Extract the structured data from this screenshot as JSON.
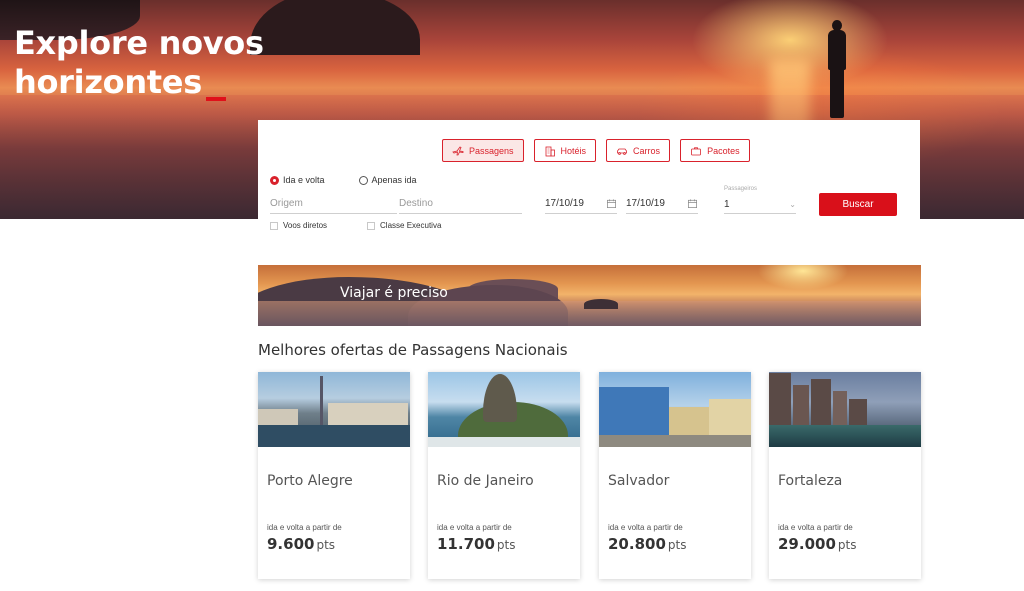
{
  "hero": {
    "title_line1": "Explore novos",
    "title_line2": "horizontes"
  },
  "search": {
    "tabs": [
      {
        "label": "Passagens",
        "icon": "plane-icon",
        "active": true
      },
      {
        "label": "Hotéis",
        "icon": "building-icon",
        "active": false
      },
      {
        "label": "Carros",
        "icon": "car-icon",
        "active": false
      },
      {
        "label": "Pacotes",
        "icon": "suitcase-icon",
        "active": false
      }
    ],
    "trip_options": [
      {
        "label": "Ida e volta",
        "selected": true
      },
      {
        "label": "Apenas ida",
        "selected": false
      }
    ],
    "origin_placeholder": "Origem",
    "destination_placeholder": "Destino",
    "departure_date": "17/10/19",
    "return_date": "17/10/19",
    "passengers_label": "Passageiros",
    "passengers_value": "1",
    "search_button": "Buscar",
    "checkboxes": [
      {
        "label": "Voos diretos",
        "checked": false
      },
      {
        "label": "Classe Executiva",
        "checked": false
      }
    ]
  },
  "banner": {
    "text": "Viajar é preciso"
  },
  "offers": {
    "section_title": "Melhores ofertas de Passagens Nacionais",
    "cards": [
      {
        "city": "Porto Alegre",
        "note": "ida e volta a partir de",
        "price": "9.600",
        "unit": "pts"
      },
      {
        "city": "Rio de Janeiro",
        "note": "ida e volta a partir de",
        "price": "11.700",
        "unit": "pts"
      },
      {
        "city": "Salvador",
        "note": "ida e volta a partir de",
        "price": "20.800",
        "unit": "pts"
      },
      {
        "city": "Fortaleza",
        "note": "ida e volta a partir de",
        "price": "29.000",
        "unit": "pts"
      }
    ]
  },
  "colors": {
    "accent": "#d9101a",
    "tab_active_bg": "#fbe7e6"
  }
}
